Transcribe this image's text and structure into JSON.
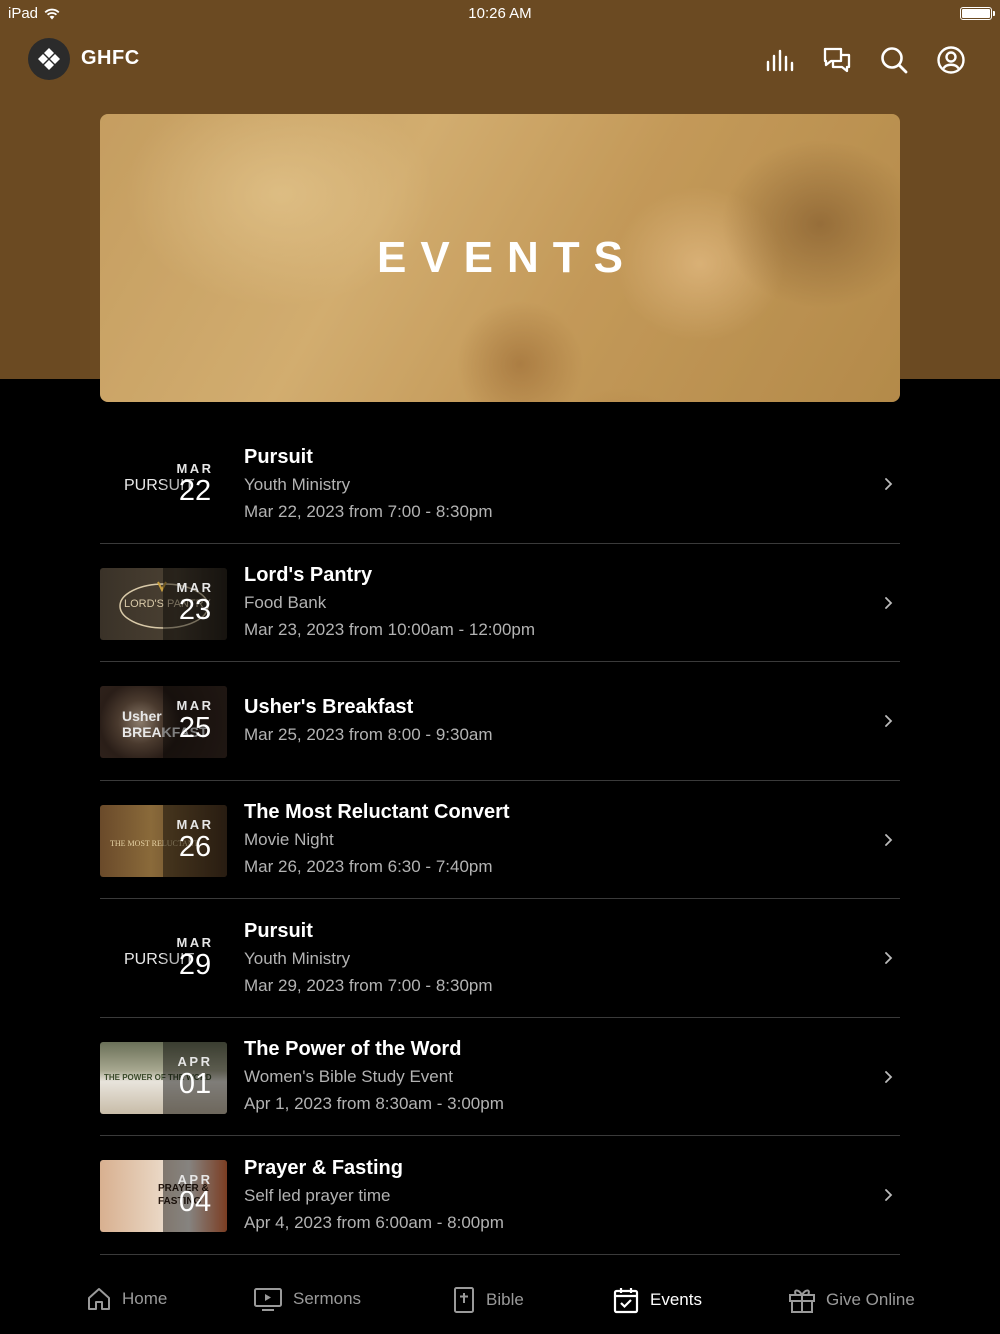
{
  "status": {
    "device": "iPad",
    "time": "10:26 AM"
  },
  "header": {
    "brand": "GHFC",
    "icons": [
      "audio-bars-icon",
      "chat-icon",
      "search-icon",
      "account-icon"
    ]
  },
  "banner": {
    "title": "EVENTS"
  },
  "events": [
    {
      "month": "MAR",
      "day": "22",
      "title": "Pursuit",
      "subtitle": "Youth Ministry",
      "when": "Mar 22, 2023 from 7:00 - 8:30pm",
      "thumb_text": "PURSUIT"
    },
    {
      "month": "MAR",
      "day": "23",
      "title": "Lord's Pantry",
      "subtitle": "Food Bank",
      "when": "Mar 23, 2023 from 10:00am - 12:00pm",
      "thumb_text": "LORD'S PANTRY"
    },
    {
      "month": "MAR",
      "day": "25",
      "title": "Usher's Breakfast",
      "subtitle": "",
      "when": "Mar 25, 2023 from 8:00 - 9:30am",
      "thumb_text": "Usher BREAKFAST"
    },
    {
      "month": "MAR",
      "day": "26",
      "title": "The Most Reluctant Convert",
      "subtitle": "Movie Night",
      "when": "Mar 26, 2023 from 6:30 - 7:40pm",
      "thumb_text": "THE MOST RELUCTANT"
    },
    {
      "month": "MAR",
      "day": "29",
      "title": "Pursuit",
      "subtitle": "Youth Ministry",
      "when": "Mar 29, 2023 from 7:00 - 8:30pm",
      "thumb_text": "PURSUIT"
    },
    {
      "month": "APR",
      "day": "01",
      "title": "The Power of the Word",
      "subtitle": "Women's Bible Study Event",
      "when": "Apr 1, 2023 from 8:30am - 3:00pm",
      "thumb_text": "THE POWER OF THE WORD"
    },
    {
      "month": "APR",
      "day": "04",
      "title": "Prayer & Fasting",
      "subtitle": "Self led prayer time",
      "when": "Apr 4, 2023 from 6:00am - 8:00pm",
      "thumb_text": "PRAYER & FASTING"
    }
  ],
  "tabs": [
    {
      "label": "Home",
      "icon": "home-icon",
      "active": false
    },
    {
      "label": "Sermons",
      "icon": "play-screen-icon",
      "active": false
    },
    {
      "label": "Bible",
      "icon": "bible-icon",
      "active": false
    },
    {
      "label": "Events",
      "icon": "calendar-check-icon",
      "active": true
    },
    {
      "label": "Give Online",
      "icon": "gift-icon",
      "active": false
    }
  ]
}
